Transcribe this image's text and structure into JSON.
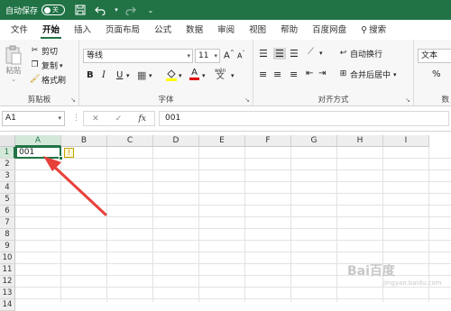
{
  "titlebar": {
    "autosave_label": "自动保存",
    "toggle_state": "关",
    "icons": [
      "save-icon",
      "undo-icon",
      "redo-icon",
      "customize-icon"
    ],
    "bg_color": "#217346"
  },
  "tabs": [
    "文件",
    "开始",
    "插入",
    "页面布局",
    "公式",
    "数据",
    "审阅",
    "视图",
    "帮助",
    "百度网盘",
    "搜索"
  ],
  "active_tab": "开始",
  "ribbon": {
    "clipboard": {
      "paste_label": "粘贴",
      "cut_label": "剪切",
      "copy_label": "复制",
      "format_painter_label": "格式刷",
      "group_label": "剪贴板"
    },
    "font": {
      "font_name": "等线",
      "font_size": "11",
      "bold": "B",
      "italic": "I",
      "underline": "U",
      "grow": "A",
      "shrink": "A",
      "font_color": "A",
      "phonetic": "wén",
      "group_label": "字体"
    },
    "alignment": {
      "wrap_text_label": "自动换行",
      "merge_center_label": "合并后居中",
      "group_label": "对齐方式"
    },
    "number": {
      "format": "文本",
      "group_label": "数"
    }
  },
  "formula_bar": {
    "name_box": "A1",
    "cancel": "✕",
    "enter": "✓",
    "fx": "fx",
    "content": "001"
  },
  "grid": {
    "columns": [
      "A",
      "B",
      "C",
      "D",
      "E",
      "F",
      "G",
      "H",
      "I"
    ],
    "rows": [
      "1",
      "2",
      "3",
      "4",
      "5",
      "6",
      "7",
      "8",
      "9",
      "10",
      "11",
      "12",
      "13",
      "14"
    ],
    "selected_column": "A",
    "selected_row": "1",
    "active_cell_value": "001",
    "smart_tag": "!"
  },
  "watermark": {
    "text": "Bai百度",
    "sub": "jingyan.baidu.com"
  }
}
